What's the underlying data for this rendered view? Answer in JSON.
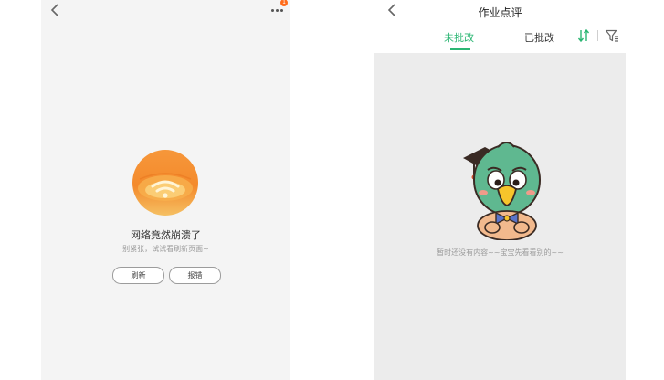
{
  "left_screen": {
    "more_badge": "1",
    "error_title": "网络竟然崩溃了",
    "error_subtitle": "别紧张，试试看刷新页面~",
    "refresh_label": "刷新",
    "report_label": "报错"
  },
  "right_screen": {
    "title": "作业点评",
    "tabs": [
      {
        "label": "未批改",
        "active": true
      },
      {
        "label": "已批改",
        "active": false
      }
    ],
    "empty_message": "暂时还没有内容~~宝宝先看看别的~~"
  },
  "colors": {
    "accent": "#2bb673",
    "badge": "#ff6b1a",
    "error_orange": "#f5892a"
  },
  "icons": {
    "back": "chevron-left-icon",
    "more": "more-dots-icon",
    "sort": "sort-icon",
    "filter": "filter-icon"
  }
}
